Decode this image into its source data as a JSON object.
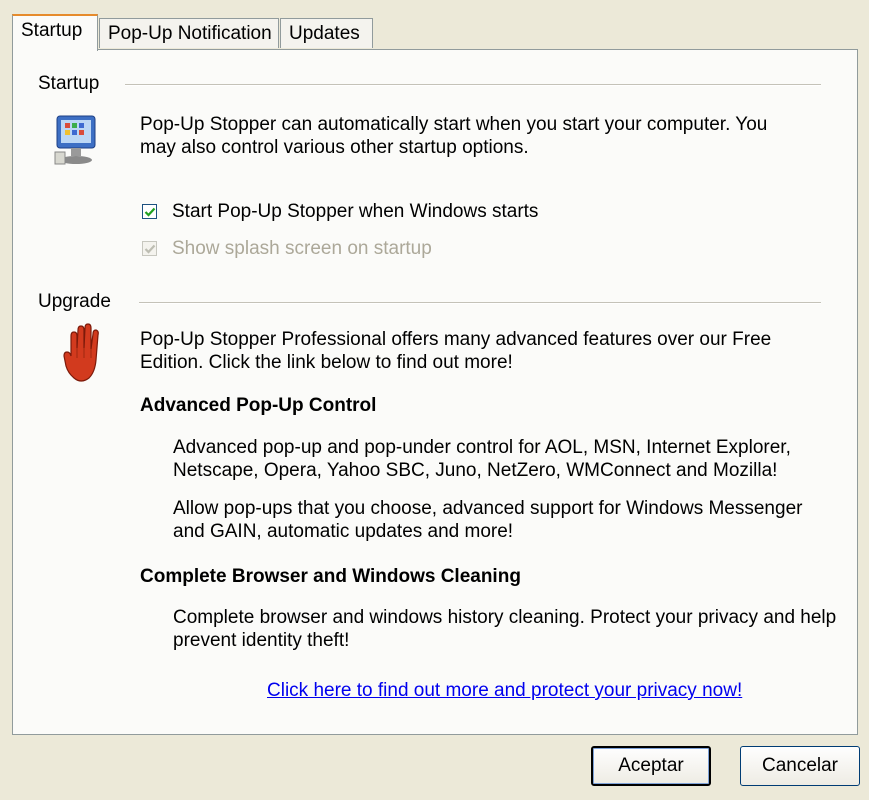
{
  "tabs": [
    {
      "label": "Startup"
    },
    {
      "label": "Pop-Up Notification"
    },
    {
      "label": "Updates"
    }
  ],
  "startup": {
    "heading": "Startup",
    "description_line1": "Pop-Up Stopper can automatically start when you start your computer. You",
    "description_line2": "may also control various other startup options.",
    "option_start_windows": {
      "label": "Start Pop-Up Stopper when Windows starts",
      "checked": true,
      "enabled": true
    },
    "option_splash": {
      "label": "Show splash screen on startup",
      "checked": true,
      "enabled": false
    },
    "icon": "monitor-computer-icon"
  },
  "upgrade": {
    "heading": "Upgrade",
    "icon": "red-hand-stop-icon",
    "description_line1": "Pop-Up Stopper Professional offers many advanced features over our Free",
    "description_line2": "Edition. Click the link below to find out more!",
    "feature1_title": "Advanced Pop-Up Control",
    "feature1_p1_line1": "Advanced pop-up and pop-under control for AOL, MSN, Internet Explorer,",
    "feature1_p1_line2": "Netscape, Opera, Yahoo SBC, Juno, NetZero, WMConnect and Mozilla!",
    "feature1_p2_line1": "Allow pop-ups that you choose, advanced support for Windows Messenger",
    "feature1_p2_line2": "and GAIN, automatic updates and more!",
    "feature2_title": "Complete Browser and Windows Cleaning",
    "feature2_p1_line1": "Complete browser and windows history cleaning. Protect your privacy and help",
    "feature2_p1_line2": "prevent identity theft!",
    "link_text": "Click here to find out more and protect your privacy now!"
  },
  "buttons": {
    "ok": "Aceptar",
    "cancel": "Cancelar"
  }
}
